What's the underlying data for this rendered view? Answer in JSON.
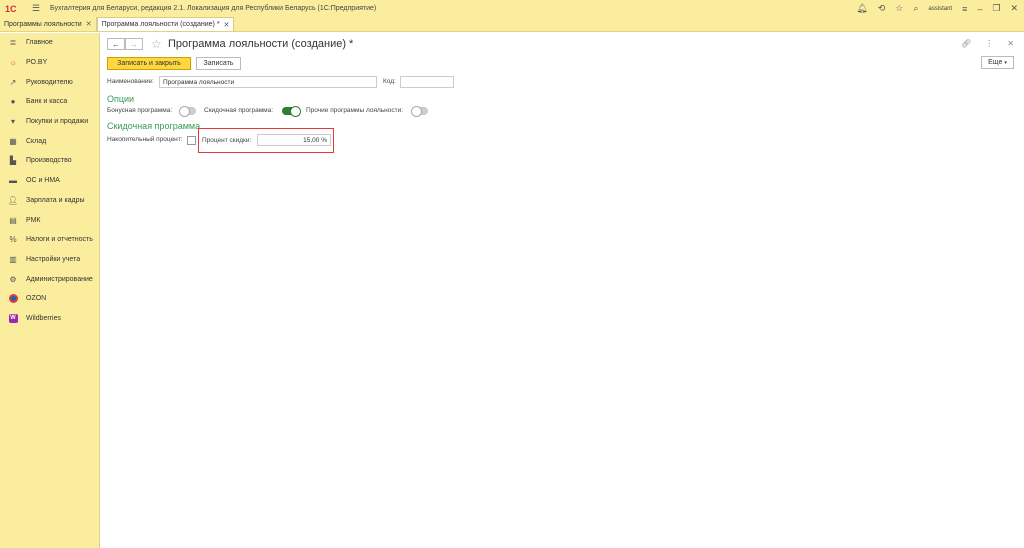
{
  "titlebar": {
    "logo": "1С",
    "app_title": "Бухгалтерия для Беларуси, редакция 2.1. Локализация для Республики Беларусь   (1С:Предприятие)",
    "user": "assistant"
  },
  "tabs": [
    {
      "label": "Программы лояльности",
      "active": false
    },
    {
      "label": "Программа лояльности (создание) *",
      "active": true
    }
  ],
  "sidebar": {
    "items": [
      {
        "label": "Главное",
        "icon": "menu-lines-icon"
      },
      {
        "label": "РО.BY",
        "icon": "sun-icon"
      },
      {
        "label": "Руководителю",
        "icon": "trend-icon"
      },
      {
        "label": "Банк и касса",
        "icon": "coin-icon"
      },
      {
        "label": "Покупки и продажи",
        "icon": "cart-icon"
      },
      {
        "label": "Склад",
        "icon": "warehouse-icon"
      },
      {
        "label": "Производство",
        "icon": "factory-icon"
      },
      {
        "label": "ОС и НМА",
        "icon": "truck-icon"
      },
      {
        "label": "Зарплата и кадры",
        "icon": "person-icon"
      },
      {
        "label": "РМК",
        "icon": "register-icon"
      },
      {
        "label": "Налоги и отчетность",
        "icon": "percent-icon"
      },
      {
        "label": "Настройки учета",
        "icon": "settings-doc-icon"
      },
      {
        "label": "Администрирование",
        "icon": "gear-icon"
      },
      {
        "label": "OZON",
        "icon": "ozon-icon"
      },
      {
        "label": "Wildberries",
        "icon": "wildberries-icon"
      }
    ]
  },
  "form": {
    "title": "Программа лояльности (создание) *",
    "save_close_label": "Записать и закрыть",
    "save_label": "Записать",
    "more_label": "Еще",
    "name_label": "Наименование:",
    "name_value": "Программа лояльности",
    "code_label": "Код:",
    "code_value": "",
    "options_header": "Опции",
    "bonus_label": "Бонусная программа:",
    "bonus_on": false,
    "discount_label": "Скидочная программа:",
    "discount_on": true,
    "other_label": "Прочие программы лояльности:",
    "other_on": false,
    "discount_section": "Скидочная программа",
    "cumulative_label": "Накопительный процент:",
    "cumulative_checked": false,
    "percent_label": "Процент скидки:",
    "percent_value": "15,00 %"
  },
  "colors": {
    "panel": "#fbed9e",
    "accent_button": "#ffd740",
    "section_green": "#3b9a58",
    "toggle_on": "#2e7d32",
    "highlight_red": "#e53935"
  }
}
